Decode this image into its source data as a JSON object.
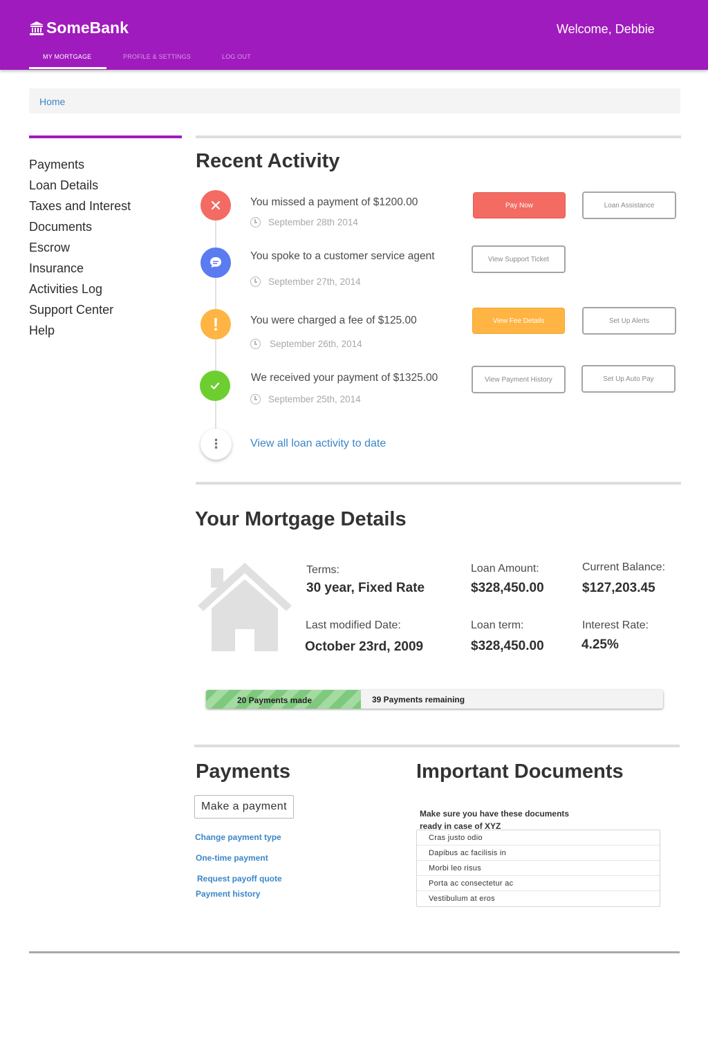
{
  "header": {
    "brand": "SomeBank",
    "welcome": "Welcome, Debbie",
    "tabs": [
      {
        "label": "MY MORTGAGE",
        "active": true
      },
      {
        "label": "PROFILE & SETTINGS",
        "active": false
      },
      {
        "label": "LOG OUT",
        "active": false
      }
    ],
    "brand_color": "#a01bbd"
  },
  "breadcrumb": {
    "home": "Home"
  },
  "sidebar": {
    "items": [
      {
        "label": "Payments"
      },
      {
        "label": "Loan Details"
      },
      {
        "label": "Taxes and Interest"
      },
      {
        "label": "Documents"
      },
      {
        "label": "Escrow"
      },
      {
        "label": "Insurance"
      },
      {
        "label": "Activities Log"
      },
      {
        "label": "Support Center"
      },
      {
        "label": "Help"
      }
    ]
  },
  "recent_activity": {
    "title": "Recent Activity",
    "items": [
      {
        "text": "You missed a payment of $1200.00",
        "date": "September 28th 2014",
        "icon": "close-icon",
        "color": "#f36b63",
        "buttons": [
          "Pay Now",
          "Loan Assistance"
        ]
      },
      {
        "text": "You spoke to a customer service agent",
        "date": "September 27th, 2014",
        "icon": "chat-icon",
        "color": "#5b7cf0",
        "buttons": [
          "View Support Ticket"
        ]
      },
      {
        "text": "You were charged a fee of $125.00",
        "date": "September 26th, 2014",
        "icon": "exclamation-icon",
        "color": "#ffb443",
        "buttons": [
          "View Fee Details",
          "Set Up Alerts"
        ]
      },
      {
        "text": "We received your payment of $1325.00",
        "date": "September 25th, 2014",
        "icon": "check-icon",
        "color": "#6ccf2f",
        "buttons": [
          "View Payment History",
          "Set Up Auto Pay"
        ]
      }
    ],
    "view_all": "View all loan activity to date"
  },
  "mortgage": {
    "title": "Your Mortgage Details",
    "terms_label": "Terms:",
    "terms_value": "30 year, Fixed Rate",
    "loan_amount_label": "Loan Amount:",
    "loan_amount_value": "$328,450.00",
    "current_balance_label": "Current Balance:",
    "current_balance_value": "$127,203.45",
    "modified_label": "Last modified Date:",
    "modified_value": "October 23rd, 2009",
    "loan_term_label": "Loan term:",
    "loan_term_value": "$328,450.00",
    "interest_label": "Interest Rate:",
    "interest_value": "4.25%",
    "progress": {
      "made_label": "20 Payments made",
      "remaining_label": "39 Payments remaining",
      "made": 20,
      "remaining": 39
    }
  },
  "payments": {
    "title": "Payments",
    "make_payment": "Make a payment",
    "links": [
      "Change payment type",
      "One-time payment",
      "Request payoff quote",
      "Payment history"
    ]
  },
  "documents": {
    "title": "Important Documents",
    "note": "Make sure you have these documents ready in case of XYZ",
    "items": [
      "Cras justo odio",
      "Dapibus ac facilisis in",
      "Morbi leo risus",
      "Porta ac consectetur ac",
      "Vestibulum at eros"
    ]
  }
}
